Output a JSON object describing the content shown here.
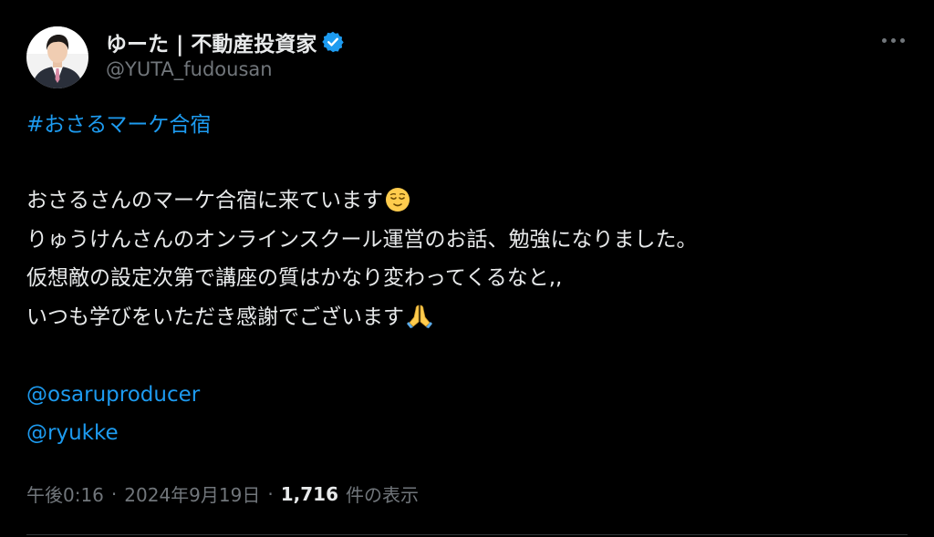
{
  "author": {
    "display_name": "ゆーた | 不動産投資家",
    "handle": "@YUTA_fudousan",
    "verified": true
  },
  "tweet": {
    "hashtag": "#おさるマーケ合宿",
    "lines": [
      "おさるさんのマーケ合宿に来ています",
      "りゅうけんさんのオンラインスクール運営のお話、勉強になりました。",
      "仮想敵の設定次第で講座の質はかなり変わってくるなと,,",
      "いつも学びをいただき感謝でございます"
    ],
    "mentions": [
      "@osaruproducer",
      "@ryukke"
    ]
  },
  "meta": {
    "time": "午後0:16",
    "separator": "·",
    "date": "2024年9月19日",
    "views_count": "1,716",
    "views_label": "件の表示"
  },
  "icons": {
    "verified": "verified-badge-icon",
    "more": "more-options-icon",
    "emoji_1": "relieved-face-emoji",
    "emoji_2": "folded-hands-emoji"
  },
  "colors": {
    "background": "#000000",
    "text": "#e7e9ea",
    "secondary": "#71767b",
    "link": "#1d9bf0"
  }
}
